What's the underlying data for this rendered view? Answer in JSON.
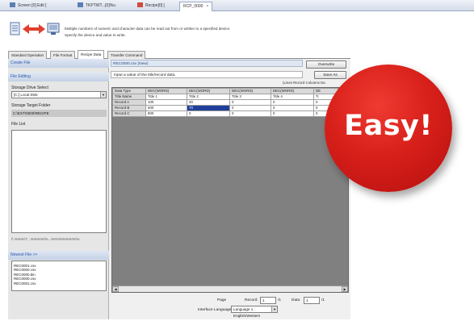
{
  "tabs": [
    {
      "label": "Screen [0] Edit [",
      "icon": "screen-icon"
    },
    {
      "label": "TKPTWT...[0]%u",
      "icon": "document-icon"
    },
    {
      "label": "Recipe[0] [",
      "icon": "recipe-icon"
    },
    {
      "label": "RCP_0000",
      "close": "×"
    }
  ],
  "header": {
    "desc_line1": "Multiple numbers of numeric and character data can be read out from or written to a specified device.",
    "desc_line2": "Specify the device and value to write."
  },
  "section_tabs": [
    "Standard Operation",
    "File Format",
    "Recipe Data",
    "Transfer Command"
  ],
  "left": {
    "create_file": "Create File",
    "file_editing": "File Editing",
    "storage_drive_label": "Storage Drive Select",
    "storage_drive_value": "[C:] Local Disk",
    "storage_folder_label": "Storage Target Folder",
    "storage_folder_value": "C:\\EXT\\0000\\RECIPE",
    "file_list_label": "File List",
    "path_text": "\\\\ %%%\\7...%%%%\\%...%%\\%%%%%\\%",
    "newest_file": "Newest File >>",
    "newest_files": [
      "REC0001.csv",
      "REC0000.csv",
      "REC0000.bin",
      "REC0000.csv",
      "REC0001.csv"
    ]
  },
  "right": {
    "file_title": "REC0000.csv (New)",
    "overwrite": "Overwrite",
    "save_as": "Save As",
    "instruction": "Input a value of the title/record data.",
    "lines_text": "(Lines Record Columns Da",
    "table": {
      "type_row": [
        "Data Type",
        "DEC(WORD)",
        "DEC(WORD)",
        "DEC(WORD)",
        "DEC(WORD)",
        "DE"
      ],
      "title_row": [
        "Title Name",
        "Title 1",
        "Title 2",
        "Title 3",
        "Title 4",
        "Ti"
      ],
      "rows": [
        [
          "Record A",
          "100",
          "30",
          "0",
          "0",
          "0"
        ],
        [
          "Record B",
          "600",
          "70",
          "0",
          "0",
          "0"
        ],
        [
          "Record C",
          "800",
          "0",
          "0",
          "0",
          "0"
        ]
      ]
    },
    "page_label": "Page",
    "record_label": "Record",
    "record_value": "1",
    "record_total": "/1",
    "data_label": "Data",
    "data_value": "1",
    "data_total": "/1",
    "interface_language_label": "Interface Language",
    "interface_language_value": "Language 1 : English/Western"
  },
  "badge": {
    "text": "Easy!",
    "color": "#d8201a"
  }
}
